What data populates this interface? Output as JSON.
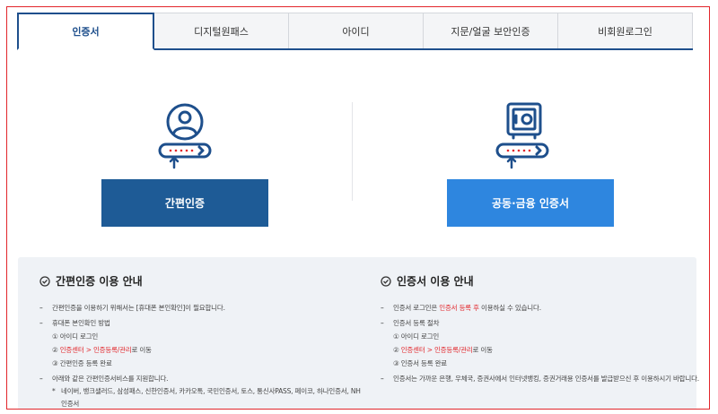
{
  "tabs": [
    {
      "label": "인증서",
      "active": true
    },
    {
      "label": "디지털원패스",
      "active": false
    },
    {
      "label": "아이디",
      "active": false
    },
    {
      "label": "지문/얼굴 보안인증",
      "active": false
    },
    {
      "label": "비회원로그인",
      "active": false
    }
  ],
  "methods": {
    "simple": {
      "label": "간편인증",
      "icon": "person-key-icon"
    },
    "cert": {
      "label": "공동·금융 인증서",
      "icon": "safe-key-icon"
    }
  },
  "guide": {
    "simple": {
      "title": "간편인증 이용 안내",
      "item1": "간편인증을 이용하기 위해서는 [휴대폰 본인확인]이 필요합니다.",
      "item2": "휴대폰 본인확인 방법",
      "step1": "① 아이디 로그인",
      "step2_prefix": "② ",
      "step2_red": "인증센터 > 인증등록/관리",
      "step2_suffix": "로 이동",
      "step3": "③ 간편인증 등록 완료",
      "item3": "아래와 같은 간편인증서비스를 지원합니다.",
      "note": "네이버, 뱅크샐러드, 삼성패스, 신한인증서, 카카오톡, 국민인증서, 토스, 통신사PASS, 페이코, 하나인증서, NH인증서"
    },
    "cert": {
      "title": "인증서 이용 안내",
      "item1_prefix": "인증서 로그인은 ",
      "item1_red": "인증서 등록 후",
      "item1_suffix": " 이용하실 수 있습니다.",
      "item2": "인증서 등록 절차",
      "step1": "① 아이디 로그인",
      "step2_prefix": "② ",
      "step2_red": "인증센터 > 인증등록/관리",
      "step2_suffix": "로 이동",
      "step3": "③ 인증서 등록 완료",
      "item3": "인증서는 가까운 은행, 우체국, 증권사에서 인터넷뱅킹, 증권거래용 인증서를 발급받으신 후 이용하시기 바랍니다."
    }
  },
  "colors": {
    "accent": "#1e5b96",
    "accent_light": "#2e86df",
    "highlight": "#e2262b"
  }
}
